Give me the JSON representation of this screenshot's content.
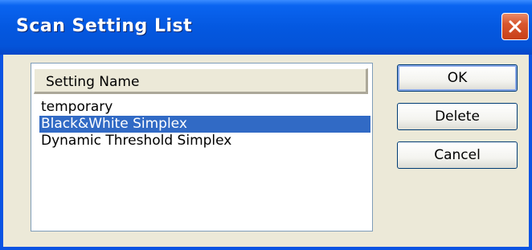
{
  "window": {
    "title": "Scan Setting List",
    "close_icon": "close-icon"
  },
  "list": {
    "column_header": "Setting Name",
    "items": [
      {
        "label": "temporary",
        "selected": false
      },
      {
        "label": "Black&White Simplex",
        "selected": true
      },
      {
        "label": "Dynamic Threshold Simplex",
        "selected": false
      }
    ]
  },
  "buttons": {
    "ok": "OK",
    "delete": "Delete",
    "cancel": "Cancel"
  },
  "colors": {
    "titlebar": "#0458e0",
    "selection": "#316ac5",
    "close_button": "#d8562e"
  }
}
